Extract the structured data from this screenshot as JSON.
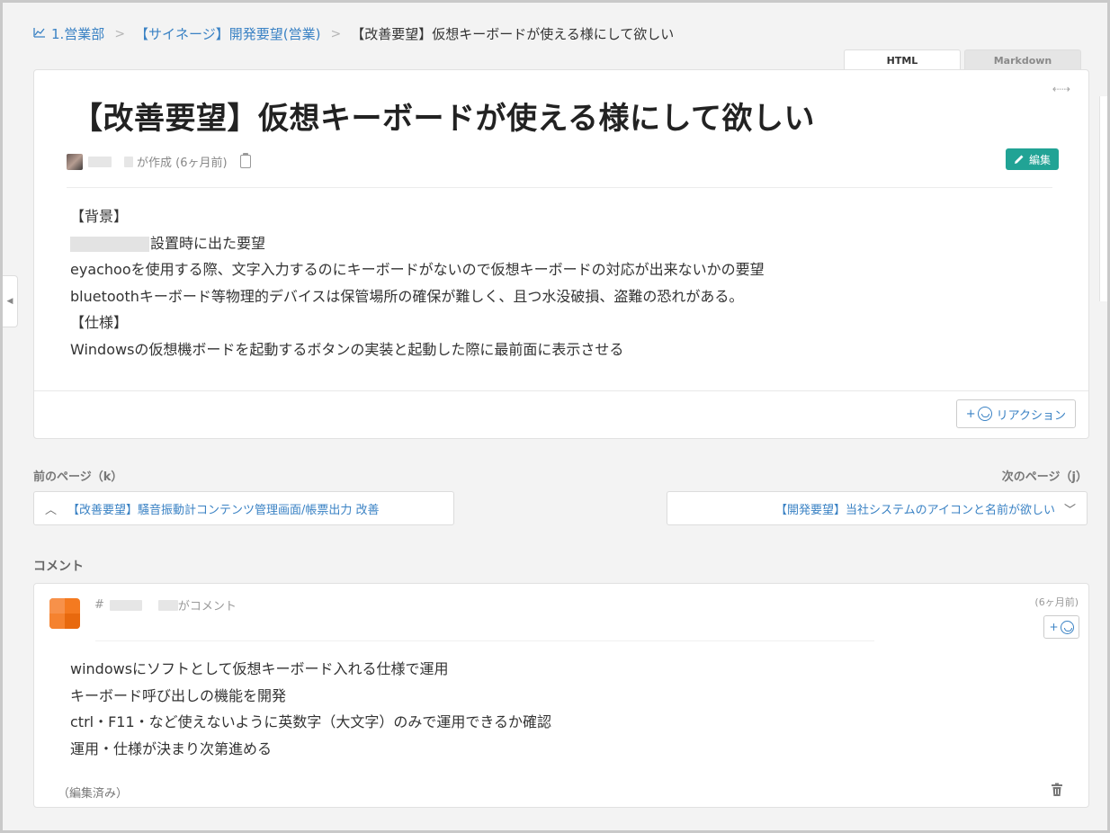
{
  "breadcrumb": {
    "items": [
      "1.営業部",
      "【サイネージ】開発要望(営業)",
      "【改善要望】仮想キーボードが使える様にして欲しい"
    ]
  },
  "view_tabs": {
    "html": "HTML",
    "markdown": "Markdown"
  },
  "page": {
    "title": "【改善要望】仮想キーボードが使える様にして欲しい",
    "created_text": "が作成 (6ヶ月前)",
    "edit_label": "編集",
    "body_lines": [
      "【背景】",
      "設置時に出た要望",
      "eyachooを使用する際、文字入力するのにキーボードがないので仮想キーボードの対応が出来ないかの要望",
      "bluetoothキーボード等物理的デバイスは保管場所の確保が難しく、且つ水没破損、盗難の恐れがある。",
      "【仕様】",
      "Windowsの仮想機ボードを起動するボタンの実装と起動した際に最前面に表示させる"
    ],
    "reaction_plus": "+",
    "reaction_label": "リアクション"
  },
  "pager": {
    "prev_label": "前のページ（k）",
    "next_label": "次のページ（j）",
    "prev_title": "【改善要望】騒音振動計コンテンツ管理画面/帳票出力 改善",
    "next_title": "【開発要望】当社システムのアイコンと名前が欲しい"
  },
  "comments": {
    "heading": "コメント",
    "author_prefix": "#",
    "author_suffix": "がコメント",
    "time": "(6ヶ月前)",
    "react_plus": "+",
    "lines": [
      "windowsにソフトとして仮想キーボード入れる仕様で運用",
      "キーボード呼び出しの機能を開発",
      "ctrl・F11・など使えないように英数字（大文字）のみで運用できるか確認",
      "運用・仕様が決まり次第進める"
    ],
    "edited": "（編集済み）"
  },
  "colors": {
    "link": "#3a82c4",
    "accent": "#21a395",
    "avatar_orange": "#f47a20"
  },
  "icons": [
    "chart-icon",
    "expand-icon",
    "clipboard-icon",
    "pencil-icon",
    "smile-icon",
    "chevron-up-icon",
    "chevron-down-icon",
    "trash-icon"
  ]
}
